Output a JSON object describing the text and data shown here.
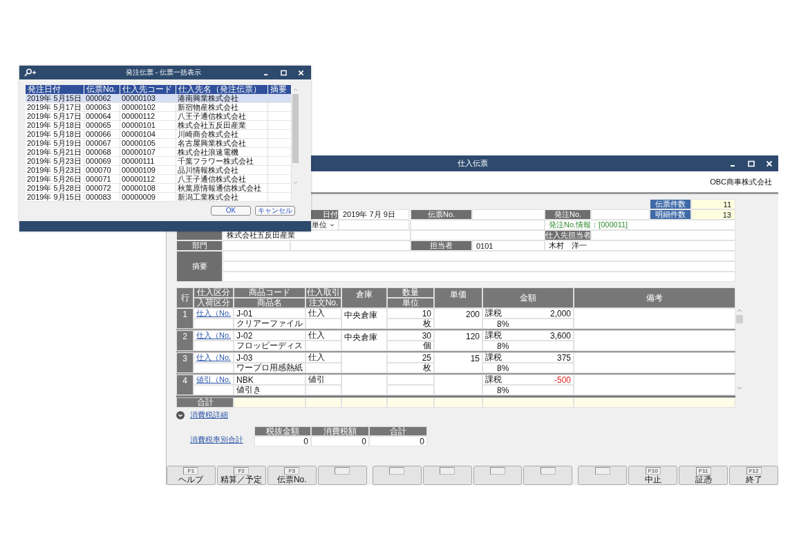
{
  "popup": {
    "title": "発注伝票 - 伝票一括表示",
    "columns": [
      "発注日付",
      "伝票No.",
      "仕入先コード",
      "仕入先名（発注伝票）",
      "摘要"
    ],
    "rows": [
      {
        "cells": [
          "2019年  5月15日",
          "000062",
          "00000103",
          "港南興業株式会社"
        ],
        "selected": true
      },
      {
        "cells": [
          "2019年  5月17日",
          "000063",
          "00000102",
          "新宿物産株式会社"
        ],
        "selected": false
      },
      {
        "cells": [
          "2019年  5月17日",
          "000064",
          "00000112",
          "八王子通信株式会社"
        ],
        "selected": false
      },
      {
        "cells": [
          "2019年  5月18日",
          "000065",
          "00000101",
          "株式会社五反田産業"
        ],
        "selected": false
      },
      {
        "cells": [
          "2019年  5月18日",
          "000066",
          "00000104",
          "川崎商会株式会社"
        ],
        "selected": false
      },
      {
        "cells": [
          "2019年  5月19日",
          "000067",
          "00000105",
          "名古屋興業株式会社"
        ],
        "selected": false
      },
      {
        "cells": [
          "2019年  5月21日",
          "000068",
          "00000107",
          "株式会社浪速電機"
        ],
        "selected": false
      },
      {
        "cells": [
          "2019年  5月23日",
          "000069",
          "00000111",
          "千葉フラワー株式会社"
        ],
        "selected": false
      },
      {
        "cells": [
          "2019年  5月23日",
          "000070",
          "00000109",
          "品川情報株式会社"
        ],
        "selected": false
      },
      {
        "cells": [
          "2019年  5月26日",
          "000071",
          "00000112",
          "八王子通信株式会社"
        ],
        "selected": false
      },
      {
        "cells": [
          "2019年  5月28日",
          "000072",
          "00000108",
          "秋葉原情報通信株式会社"
        ],
        "selected": false
      },
      {
        "cells": [
          "2019年  9月15日",
          "000083",
          "00000009",
          "新潟工業株式会社"
        ],
        "selected": false
      }
    ],
    "buttons": [
      "OK",
      "キャンセル"
    ]
  },
  "main": {
    "title": "仕入伝票",
    "company": "OBC商事株式会社",
    "counters": [
      {
        "label": "伝票件数",
        "value": "11"
      },
      {
        "label": "明細件数",
        "value": "13"
      }
    ],
    "header": {
      "date_label": "日付",
      "date": "2019年  7月  9日",
      "slip_no_label": "伝票No.",
      "order_no_label": "発注No.",
      "unit_select": "単位",
      "order_info": "発注No.情報：[000011]",
      "supplier": "株式会社五反田産業",
      "supplier_staff_label": "仕入先担当者",
      "dept_label": "部門",
      "staff_label": "担当者",
      "staff_code": "0101",
      "staff_name": "木村　洋一",
      "memo_label": "摘要"
    },
    "table": {
      "header_top": [
        "行",
        "仕入区分",
        "商品コード",
        "仕入取引",
        "倉庫",
        "数量",
        "単価",
        "金額",
        "備考"
      ],
      "header_bottom": [
        "入荷区分",
        "商品名",
        "注文No.",
        "単位"
      ],
      "rows": [
        {
          "no": "1",
          "type": "仕入（No.",
          "code": "J-01",
          "name": "クリアーファイル",
          "deal": "仕入",
          "warehouse": "中央倉庫",
          "qty": "10",
          "unit": "枚",
          "price": "200",
          "tax": "課税",
          "amount": "2,000",
          "rate": "8%",
          "negative": false
        },
        {
          "no": "2",
          "type": "仕入（No.",
          "code": "J-02",
          "name": "フロッピーディス",
          "deal": "仕入",
          "warehouse": "中央倉庫",
          "qty": "30",
          "unit": "個",
          "price": "120",
          "tax": "課税",
          "amount": "3,600",
          "rate": "8%",
          "negative": false
        },
        {
          "no": "3",
          "type": "仕入（No.",
          "code": "J-03",
          "name": "ワープロ用感熱紙",
          "deal": "仕入",
          "qty": "25",
          "unit": "枚",
          "price": "15",
          "tax": "課税",
          "amount": "375",
          "rate": "8%",
          "negative": false
        },
        {
          "no": "4",
          "type": "値引（No.",
          "code": "NBK",
          "name": "値引き",
          "deal": "値引",
          "tax": "課税",
          "amount": "-500",
          "rate": "8%",
          "negative": true
        }
      ],
      "total_label": "合計"
    },
    "tax_detail_link": "消費税詳細",
    "tax_summary": {
      "label": "消費税率別合計",
      "columns": [
        "税抜金額",
        "消費税額",
        "合計"
      ],
      "values": [
        "0",
        "0",
        "0"
      ]
    },
    "function_keys": [
      [
        {
          "kind": "key",
          "key": "F1",
          "label": "ヘルプ"
        },
        {
          "kind": "key",
          "key": "F2",
          "label": "精算／予定"
        },
        {
          "kind": "key",
          "key": "F3",
          "label": "伝票No."
        },
        {
          "kind": "blank"
        }
      ],
      [
        {
          "kind": "blank"
        },
        {
          "kind": "blank"
        },
        {
          "kind": "blank"
        },
        {
          "kind": "blank"
        }
      ],
      [
        {
          "kind": "blank"
        },
        {
          "kind": "key",
          "key": "F10",
          "label": "中止"
        },
        {
          "kind": "key",
          "key": "F11",
          "label": "証憑"
        },
        {
          "kind": "key",
          "key": "F12",
          "label": "終了"
        }
      ]
    ]
  }
}
